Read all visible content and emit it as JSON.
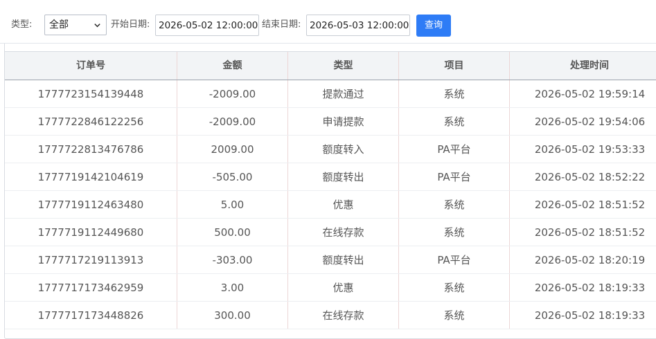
{
  "filters": {
    "type_label": "类型:",
    "type_value": "全部",
    "start_label": "开始日期:",
    "start_value": "2026-05-02 12:00:00",
    "end_label": "结束日期:",
    "end_value": "2026-05-03 12:00:00",
    "query_label": "查询"
  },
  "table": {
    "headers": [
      "订单号",
      "金额",
      "类型",
      "项目",
      "处理时间"
    ],
    "rows": [
      [
        "1777723154139448",
        "-2009.00",
        "提款通过",
        "系统",
        "2026-05-02 19:59:14"
      ],
      [
        "1777722846122256",
        "-2009.00",
        "申请提款",
        "系统",
        "2026-05-02 19:54:06"
      ],
      [
        "1777722813476786",
        "2009.00",
        "额度转入",
        "PA平台",
        "2026-05-02 19:53:33"
      ],
      [
        "1777719142104619",
        "-505.00",
        "额度转出",
        "PA平台",
        "2026-05-02 18:52:22"
      ],
      [
        "1777719112463480",
        "5.00",
        "优惠",
        "系统",
        "2026-05-02 18:51:52"
      ],
      [
        "1777719112449680",
        "500.00",
        "在线存款",
        "系统",
        "2026-05-02 18:51:52"
      ],
      [
        "1777717219113913",
        "-303.00",
        "额度转出",
        "PA平台",
        "2026-05-02 18:20:19"
      ],
      [
        "1777717173462959",
        "3.00",
        "优惠",
        "系统",
        "2026-05-02 18:19:33"
      ],
      [
        "1777717173448826",
        "300.00",
        "在线存款",
        "系统",
        "2026-05-02 18:19:33"
      ]
    ]
  },
  "icons": {
    "select_arrow": "chevron-down-icon"
  },
  "colors": {
    "accent": "#2e7cf6",
    "header_bg": "#f2f4f6",
    "text": "#555555"
  }
}
